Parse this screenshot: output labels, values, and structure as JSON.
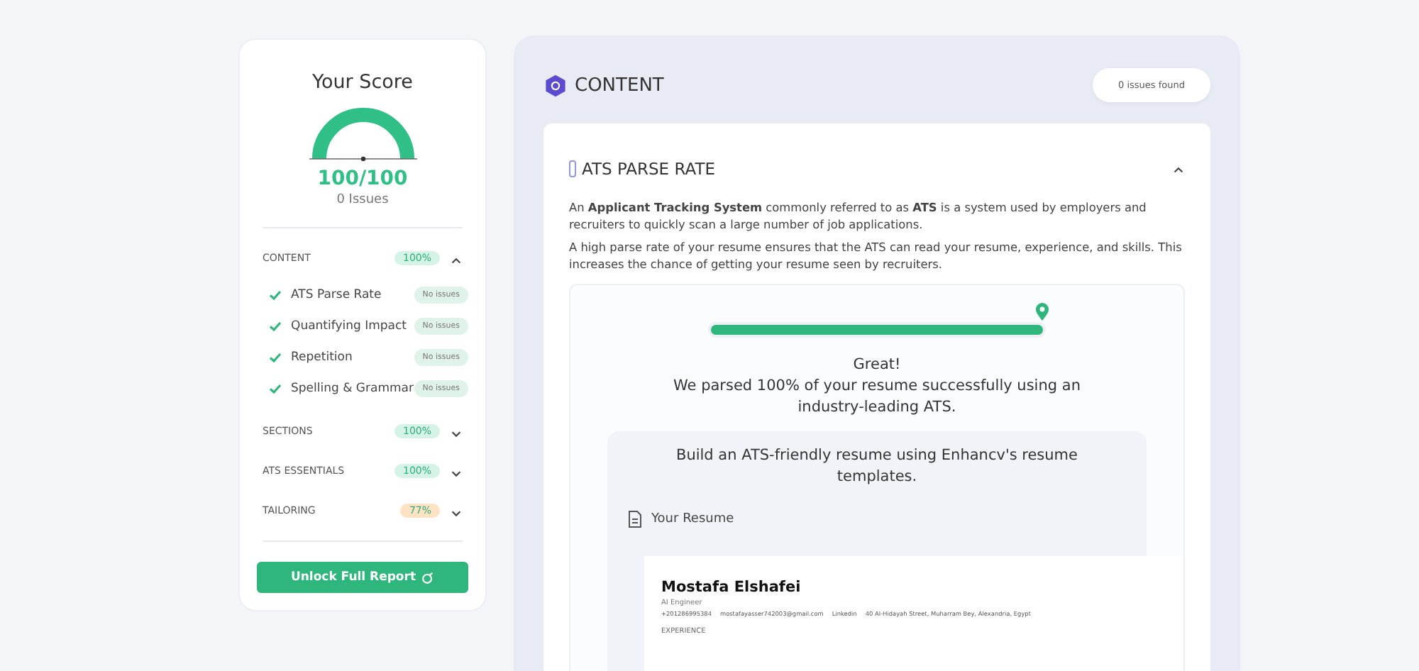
{
  "score": {
    "title": "Your Score",
    "value": "100/100",
    "issues": "0 Issues"
  },
  "sidebar": {
    "sections": [
      {
        "label": "CONTENT",
        "percent": "100%",
        "color": "#d6f3e7",
        "expanded": true,
        "items": [
          {
            "label": "ATS Parse Rate",
            "badge": "No issues"
          },
          {
            "label": "Quantifying Impact",
            "badge": "No issues"
          },
          {
            "label": "Repetition",
            "badge": "No issues"
          },
          {
            "label": "Spelling & Grammar",
            "badge": "No issues"
          }
        ]
      },
      {
        "label": "SECTIONS",
        "percent": "100%",
        "color": "#d6f3e7",
        "expanded": false
      },
      {
        "label": "ATS ESSENTIALS",
        "percent": "100%",
        "color": "#d6f3e7",
        "expanded": false
      },
      {
        "label": "TAILORING",
        "percent": "77%",
        "color": "#fde3c4",
        "expanded": false
      }
    ],
    "button": "Unlock Full Report"
  },
  "panel": {
    "title": "CONTENT",
    "issues_found": "0 issues found",
    "section": {
      "title": "ATS PARSE RATE",
      "expanded": true,
      "paragraphs": [
        "An **Applicant Tracking System** commonly referred to as **ATS** is a system used by employers and recruiters to quickly scan a large number of job applications.",
        "A high parse rate of your resume ensures that the ATS can read your resume, experience, and skills. This increases the chance of getting your resume seen by recruiters."
      ],
      "level": 1,
      "result_title": "Great!",
      "result_text": "We parsed 100% of your resume successfully using an industry-leading ATS.",
      "promo": "Build an ATS-friendly resume using Enhancv's resume templates.",
      "resume_label": "Your Resume",
      "resume": {
        "name": "Mostafa Elshafei",
        "role": "AI Engineer",
        "contacts": [
          "+201286995384",
          "mostafayasser742003@gmail.com",
          "Linkedin",
          "40 Al-Hidayah Street, Muharram Bey, Alexandria, Egypt"
        ],
        "heading": "EXPERIENCE"
      }
    }
  }
}
